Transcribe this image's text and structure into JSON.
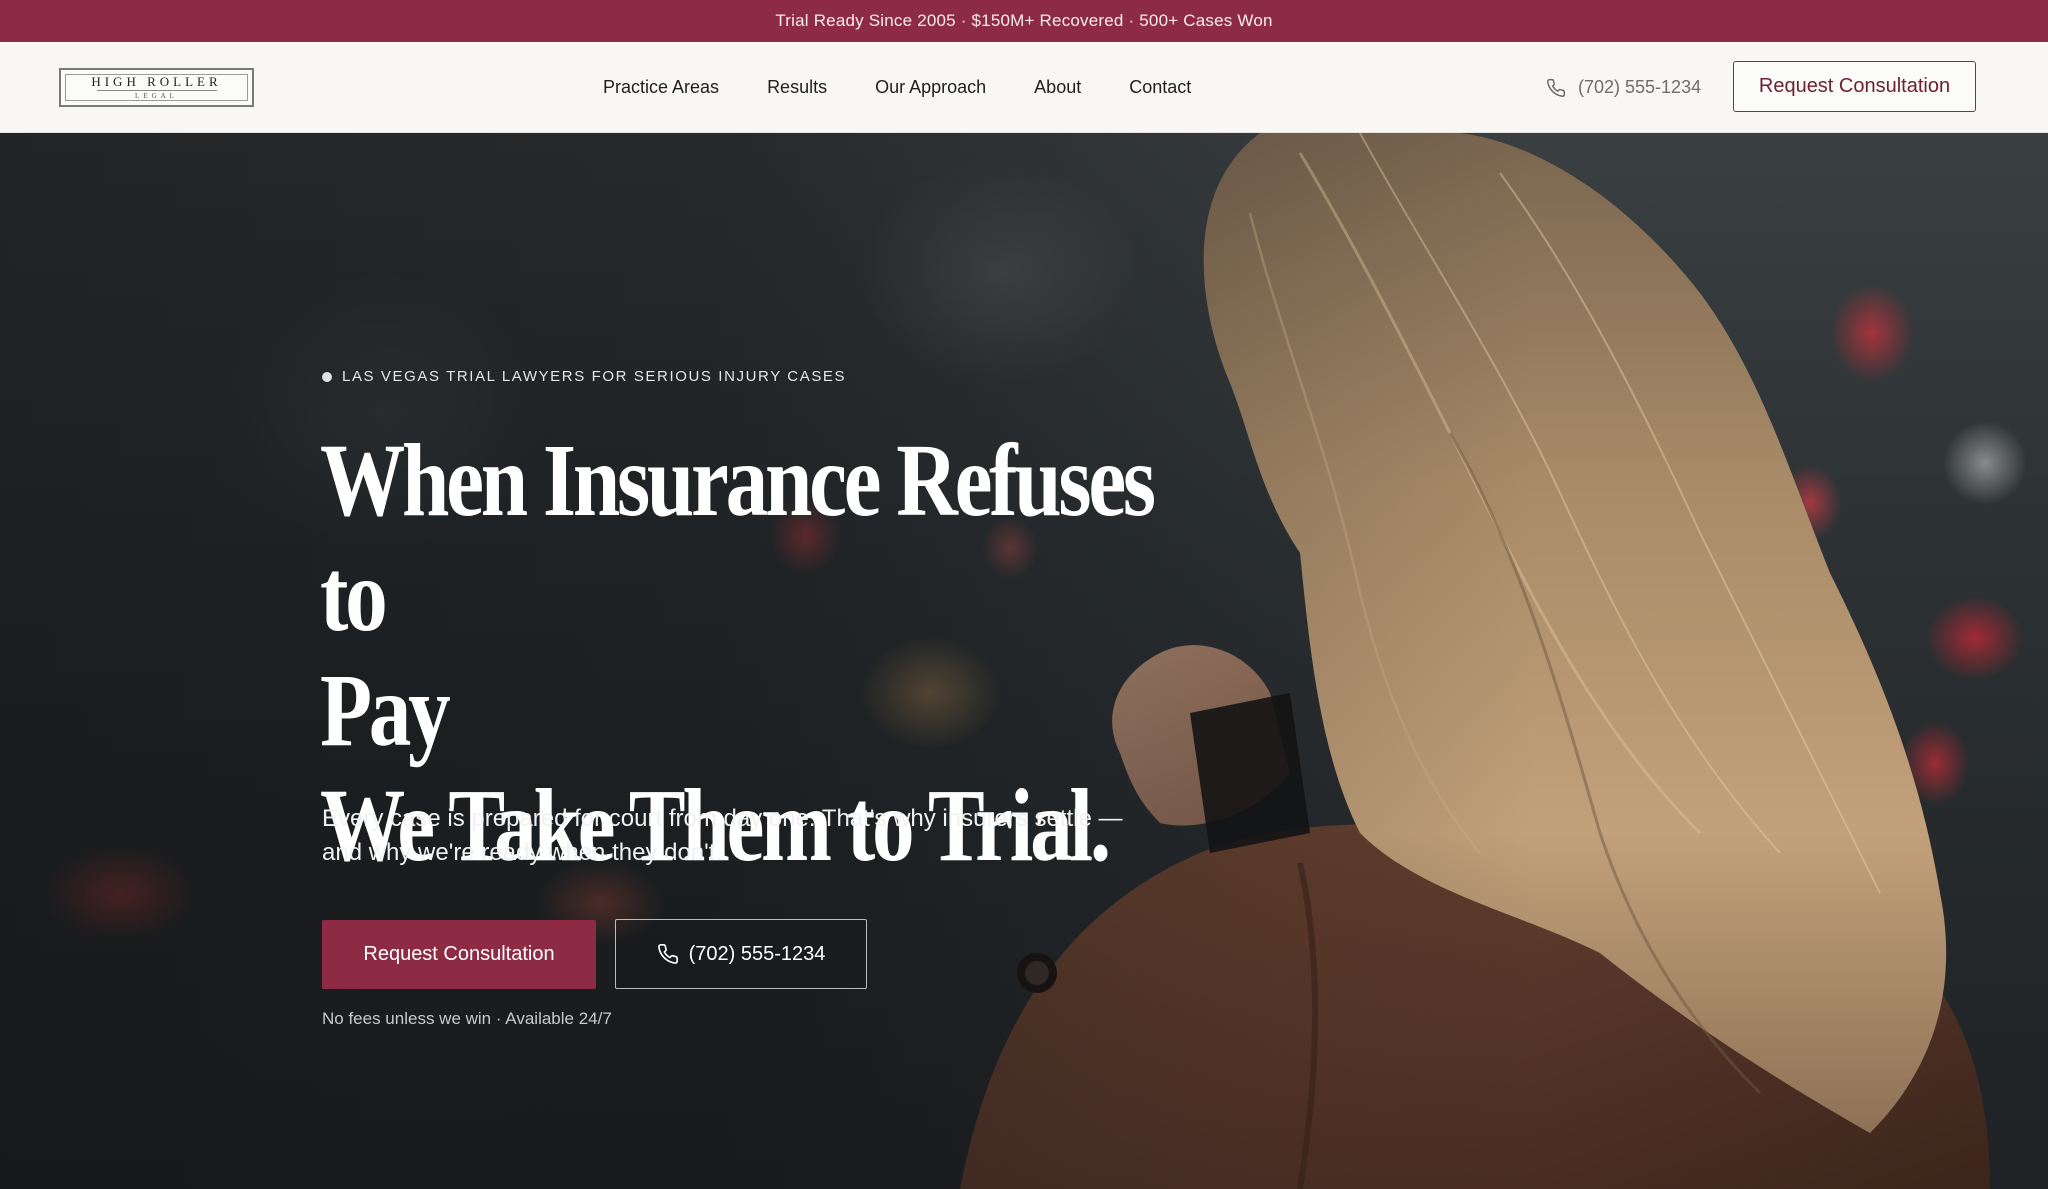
{
  "topbar": {
    "text": "Trial Ready Since 2005 · $150M+ Recovered · 500+ Cases Won",
    "background": "#8d2b45"
  },
  "header": {
    "logo": {
      "main": "HIGH ROLLER",
      "sub": "LEGAL"
    },
    "nav": [
      {
        "label": "Practice Areas"
      },
      {
        "label": "Results"
      },
      {
        "label": "Our Approach"
      },
      {
        "label": "About"
      },
      {
        "label": "Contact"
      }
    ],
    "phone": {
      "icon": "phone-icon",
      "number": "(702) 555-1234"
    },
    "cta_label": "Request Consultation"
  },
  "hero": {
    "eyebrow": "LAS VEGAS TRIAL LAWYERS FOR SERIOUS INJURY CASES",
    "headline": {
      "line1": "When Insurance Refuses to",
      "line2": "Pay",
      "line3": "We Take Them to Trial."
    },
    "subtext": "Every case is prepared for court from day one. That's why insurers settle — and why we're ready when they don't.",
    "primary_cta": "Request Consultation",
    "phone_cta": {
      "icon": "phone-icon",
      "number": "(702) 555-1234"
    },
    "fineprint": "No fees unless we win · Available 24/7"
  },
  "colors": {
    "accent": "#8d2b45",
    "header_bg": "#f8f7f5"
  }
}
